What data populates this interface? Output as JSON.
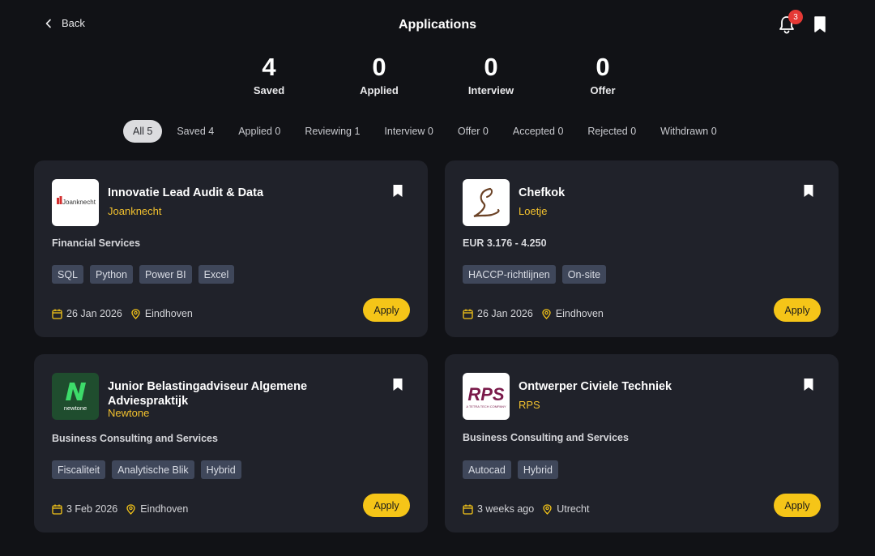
{
  "header": {
    "back_label": "Back",
    "title": "Applications",
    "notification_count": "3"
  },
  "stats": [
    {
      "value": "4",
      "label": "Saved"
    },
    {
      "value": "0",
      "label": "Applied"
    },
    {
      "value": "0",
      "label": "Interview"
    },
    {
      "value": "0",
      "label": "Offer"
    }
  ],
  "filters": [
    {
      "label": "All 5",
      "active": true
    },
    {
      "label": "Saved 4"
    },
    {
      "label": "Applied 0"
    },
    {
      "label": "Reviewing 1"
    },
    {
      "label": "Interview 0"
    },
    {
      "label": "Offer 0"
    },
    {
      "label": "Accepted 0"
    },
    {
      "label": "Rejected 0"
    },
    {
      "label": "Withdrawn 0"
    }
  ],
  "cards": [
    {
      "title": "Innovatie Lead Audit & Data",
      "company": "Joanknecht",
      "logo_text": "Joanknecht",
      "meta": "Financial Services",
      "tags": [
        "SQL",
        "Python",
        "Power BI",
        "Excel"
      ],
      "date": "26 Jan 2026",
      "location": "Eindhoven",
      "apply_label": "Apply"
    },
    {
      "title": "Chefkok",
      "company": "Loetje",
      "logo_text": "L",
      "meta": "EUR 3.176 - 4.250",
      "tags": [
        "HACCP-richtlijnen",
        "On-site"
      ],
      "date": "26 Jan 2026",
      "location": "Eindhoven",
      "apply_label": "Apply"
    },
    {
      "title": "Junior Belastingadviseur Algemene Adviespraktijk",
      "company": "Newtone",
      "logo_text": "newtone",
      "meta": "Business Consulting and Services",
      "tags": [
        "Fiscaliteit",
        "Analytische Blik",
        "Hybrid"
      ],
      "date": "3 Feb 2026",
      "location": "Eindhoven",
      "apply_label": "Apply"
    },
    {
      "title": "Ontwerper Civiele Techniek",
      "company": "RPS",
      "logo_text": "RPS",
      "logo_subtext": "A TETRA TECH COMPANY",
      "meta": "Business Consulting and Services",
      "tags": [
        "Autocad",
        "Hybrid"
      ],
      "date": "3 weeks ago",
      "location": "Utrecht",
      "apply_label": "Apply"
    }
  ],
  "colors": {
    "background": "#111216",
    "card": "#20222a",
    "accent": "#f5c518",
    "company": "#f2c12e",
    "tag": "#3f475a",
    "badge": "#e53935"
  }
}
